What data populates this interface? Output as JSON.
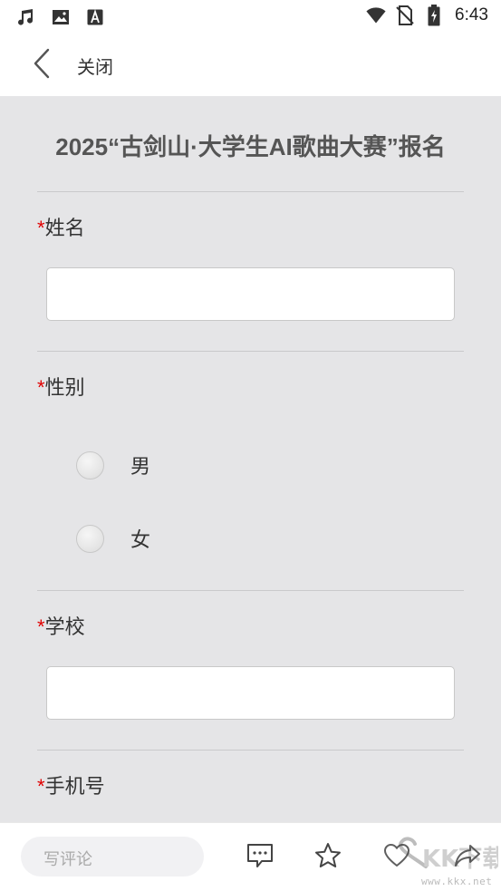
{
  "status_bar": {
    "time": "6:43",
    "left_icons": [
      "music-note-icon",
      "image-icon",
      "font-a-icon"
    ],
    "right_icons": [
      "wifi-icon",
      "no-sim-icon",
      "battery-charging-icon"
    ]
  },
  "nav": {
    "back_icon": "chevron-left-icon",
    "close_label": "关闭"
  },
  "form": {
    "title": "2025“古剑山·大学生AI歌曲大赛”报名",
    "required_mark": "*",
    "fields": [
      {
        "label": "姓名",
        "type": "text",
        "value": ""
      },
      {
        "label": "性别",
        "type": "radio",
        "options": [
          "男",
          "女"
        ],
        "selected": null
      },
      {
        "label": "学校",
        "type": "text",
        "value": ""
      },
      {
        "label": "手机号",
        "type": "text",
        "value": ""
      }
    ]
  },
  "bottom_bar": {
    "comment_placeholder": "写评论",
    "icons": [
      "comment-bubble-icon",
      "star-icon",
      "heart-icon",
      "share-icon"
    ]
  },
  "watermark": {
    "text": "www.kkx.net",
    "logo_text": "KK下载"
  },
  "colors": {
    "required": "#e00000",
    "content_bg": "#e5e5e7",
    "title_text": "#555555"
  }
}
